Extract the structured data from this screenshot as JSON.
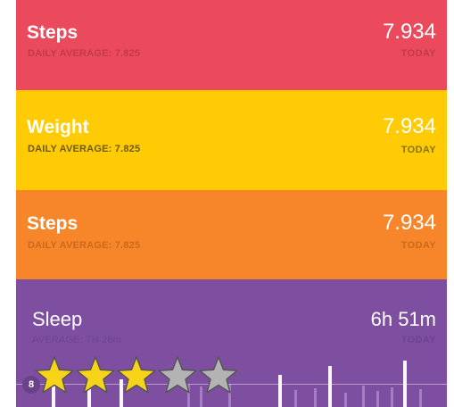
{
  "panels": [
    {
      "title": "Steps",
      "subtitle": "DAILY AVERAGE: 7.825",
      "value": "7.934",
      "value_label": "TODAY",
      "color": "#ea4a5c"
    },
    {
      "title": "Weight",
      "subtitle": "DAILY AVERAGE: 7.825",
      "value": "7.934",
      "value_label": "TODAY",
      "color": "#fecb05"
    },
    {
      "title": "Steps",
      "subtitle": "DAILY AVERAGE: 7.825",
      "value": "7.934",
      "value_label": "TODAY",
      "color": "#f68629"
    },
    {
      "title": "Sleep",
      "subtitle": "AVERAGE: 7H 28m",
      "value": "6h 51m",
      "value_label": "TODAY",
      "color": "#7e4fa1"
    }
  ],
  "sleep_chart": {
    "y_badge": "8"
  },
  "rating": {
    "value": 3,
    "max": 5,
    "filled_color": "#f7d31a",
    "empty_color": "#b3b3b3",
    "icon": "star-icon"
  }
}
